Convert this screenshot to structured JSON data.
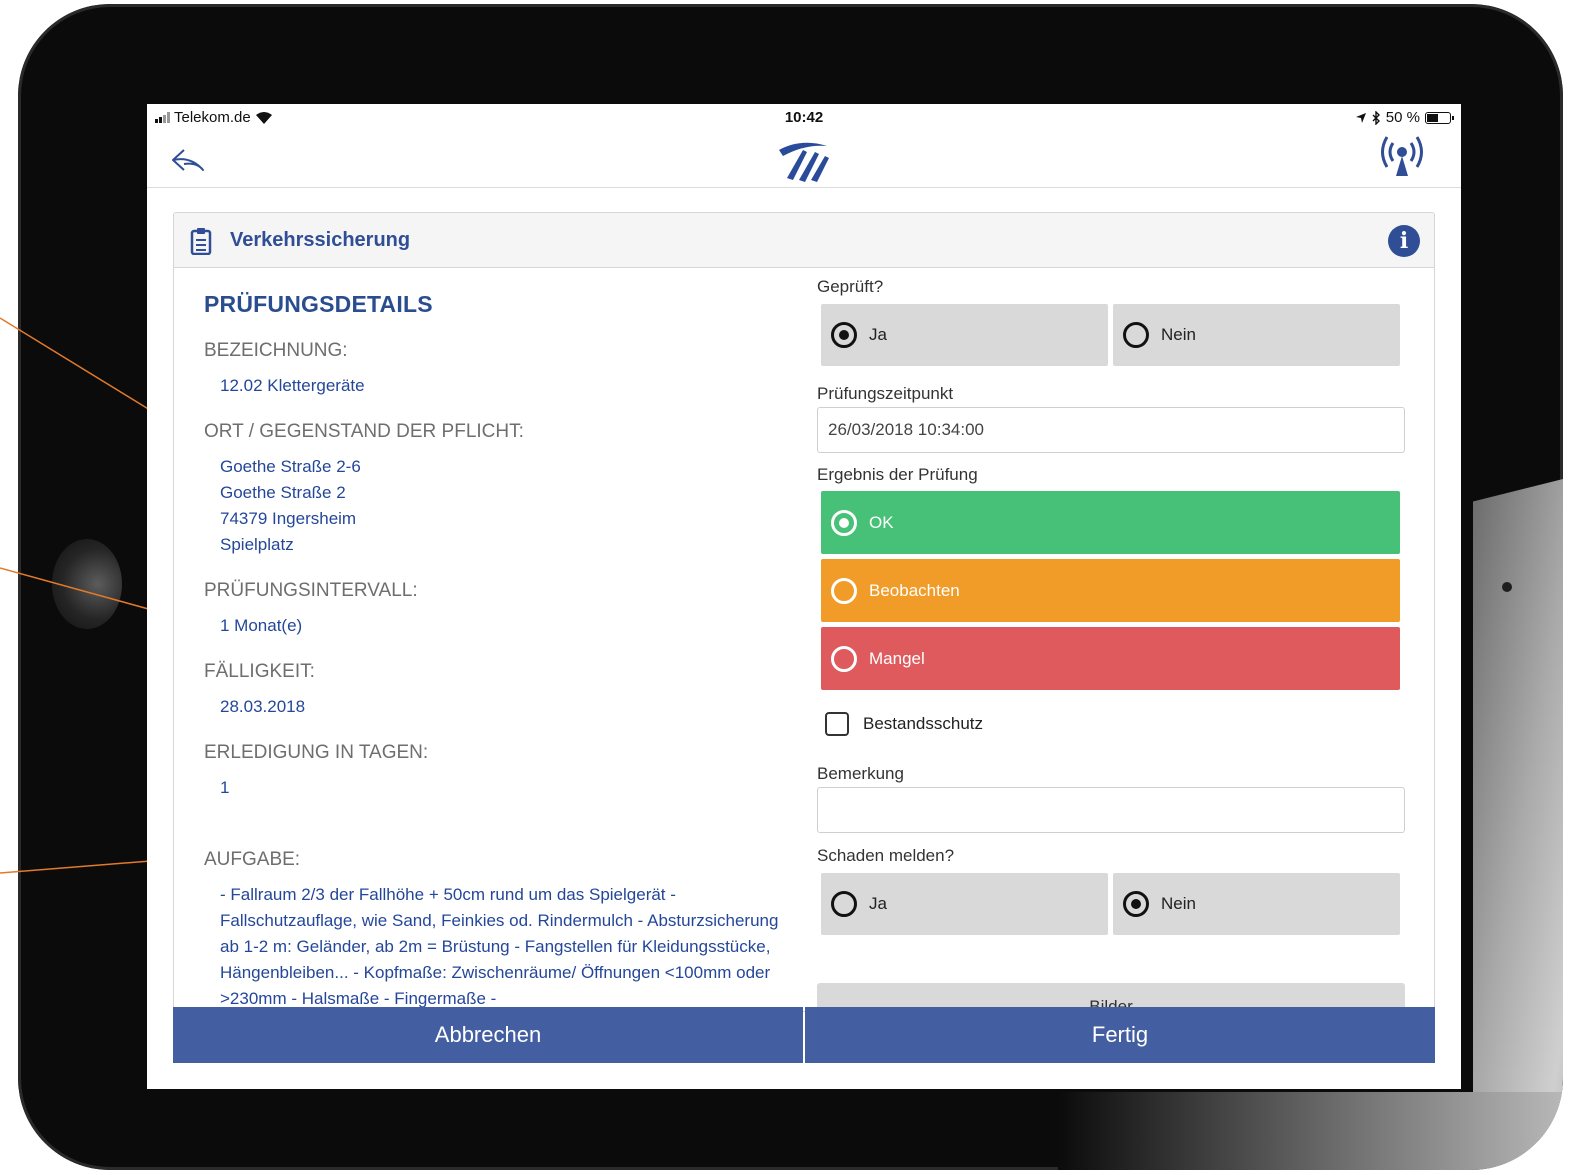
{
  "status_bar": {
    "carrier": "Telekom.de",
    "time": "10:42",
    "battery": "50 %",
    "battery_level": 0.5
  },
  "nav": {
    "back_icon": "back-arrow-icon",
    "logo_icon": "app-logo-icon",
    "signal_icon": "broadcast-icon"
  },
  "panel": {
    "title": "Verkehrssicherung"
  },
  "details": {
    "heading": "PRÜFUNGSDETAILS",
    "bezeichnung_label": "BEZEICHNUNG:",
    "bezeichnung_value": "12.02 Klettergeräte",
    "ort_label": "ORT / GEGENSTAND DER PFLICHT:",
    "ort_lines": [
      "Goethe Straße 2-6",
      "Goethe Straße 2",
      "74379 Ingersheim",
      "Spielplatz"
    ],
    "intervall_label": "PRÜFUNGSINTERVALL:",
    "intervall_value": "1 Monat(e)",
    "faelligkeit_label": "FÄLLIGKEIT:",
    "faelligkeit_value": "28.03.2018",
    "erledigung_label": "ERLEDIGUNG IN TAGEN:",
    "erledigung_value": "1",
    "aufgabe_label": "AUFGABE:",
    "aufgabe_text": "- Fallraum 2/3 der Fallhöhe + 50cm rund um das Spielgerät - Fallschutzauflage, wie Sand, Feinkies od. Rindermulch - Absturzsicherung ab 1-2 m: Geländer, ab 2m = Brüstung - Fangstellen für Kleidungsstücke, Hängenbleiben... - Kopfmaße: Zwischenräume/ Öffnungen <100mm oder >230mm - Halsmaße - Fingermaße -"
  },
  "form": {
    "geprueft_label": "Geprüft?",
    "geprueft_options": [
      "Ja",
      "Nein"
    ],
    "geprueft_selected": "Ja",
    "zeitpunkt_label": "Prüfungszeitpunkt",
    "zeitpunkt_value": "26/03/2018 10:34:00",
    "ergebnis_label": "Ergebnis der Prüfung",
    "ergebnis_options": [
      "OK",
      "Beobachten",
      "Mangel"
    ],
    "ergebnis_selected": "OK",
    "ergebnis_colors": {
      "ok": "#47c177",
      "beobachten": "#f19c28",
      "mangel": "#de5a5d"
    },
    "bestandsschutz_label": "Bestandsschutz",
    "bestandsschutz_checked": false,
    "bemerkung_label": "Bemerkung",
    "bemerkung_value": "",
    "schaden_label": "Schaden melden?",
    "schaden_options": [
      "Ja",
      "Nein"
    ],
    "schaden_selected": "Nein",
    "bilder_label": "Bilder"
  },
  "actions": {
    "cancel": "Abbrechen",
    "done": "Fertig"
  },
  "colors": {
    "primary": "#2f4e95",
    "action_bar": "#445fa1",
    "callout": "#e27a2a"
  }
}
